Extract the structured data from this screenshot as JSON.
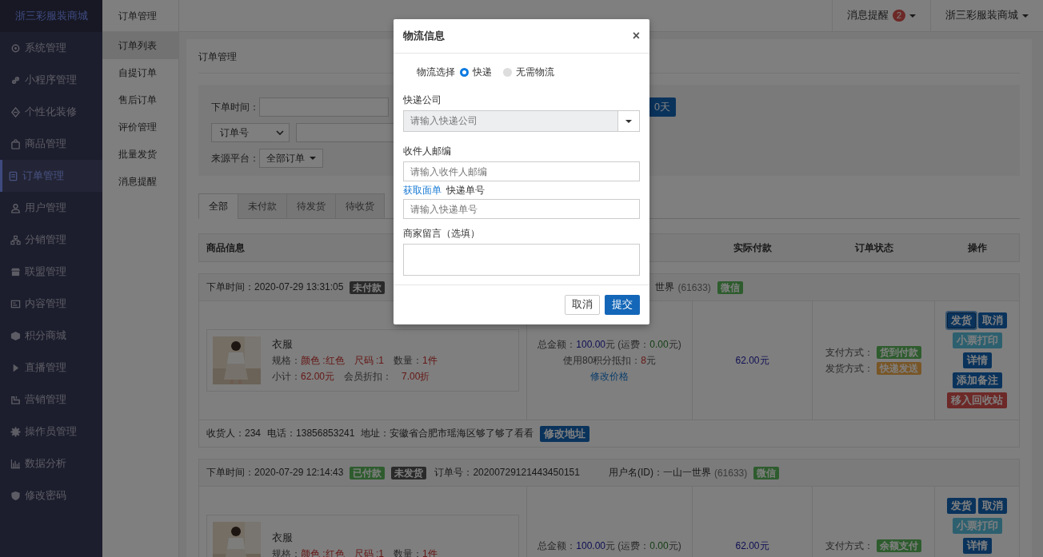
{
  "sidebar": {
    "brand": "浙三彩服装商城",
    "items": [
      {
        "label": "系统管理",
        "selected": false
      },
      {
        "label": "小程序管理",
        "selected": false
      },
      {
        "label": "个性化装修",
        "selected": false
      },
      {
        "label": "商品管理",
        "selected": false
      },
      {
        "label": "订单管理",
        "selected": true
      },
      {
        "label": "用户管理",
        "selected": false
      },
      {
        "label": "分销管理",
        "selected": false
      },
      {
        "label": "联盟管理",
        "selected": false
      },
      {
        "label": "内容管理",
        "selected": false
      },
      {
        "label": "积分商城",
        "selected": false
      },
      {
        "label": "直播管理",
        "selected": false
      },
      {
        "label": "营销管理",
        "selected": false
      },
      {
        "label": "操作员管理",
        "selected": false
      },
      {
        "label": "数据分析",
        "selected": false
      },
      {
        "label": "修改密码",
        "selected": false
      }
    ]
  },
  "submenu": {
    "title": "订单管理",
    "items": [
      {
        "label": "订单列表",
        "selected": true
      },
      {
        "label": "自提订单",
        "selected": false
      },
      {
        "label": "售后订单",
        "selected": false
      },
      {
        "label": "评价管理",
        "selected": false
      },
      {
        "label": "批量发货",
        "selected": false
      },
      {
        "label": "消息提醒",
        "selected": false
      }
    ]
  },
  "topbar": {
    "notifications": {
      "label": "消息提醒",
      "count": "2"
    },
    "account": "浙三彩服装商城"
  },
  "page": {
    "title": "订单管理",
    "filters": {
      "time_label": "下单时间：",
      "range_button": "0天",
      "search_type": "订单号",
      "source_label": "来源平台：",
      "source_value": "全部订单"
    },
    "tabs": [
      {
        "label": "全部",
        "selected": true
      },
      {
        "label": "未付款",
        "selected": false
      },
      {
        "label": "待发货",
        "selected": false
      },
      {
        "label": "待收货",
        "selected": false
      }
    ],
    "columns": [
      "商品信息",
      "实际付款",
      "订单状态",
      "操作"
    ],
    "orders": [
      {
        "time": "下单时间：2020-07-29 13:31:05",
        "badges": [
          {
            "label": "未付款",
            "color": "#2a2a2a"
          }
        ],
        "user": "世界",
        "user_id": "(61633)",
        "platform": "微信",
        "product": {
          "name": "衣服",
          "lines": [
            [
              {
                "text": "规格：",
                "kind": "label"
              },
              {
                "text": "颜色 :红色",
                "kind": "value"
              },
              {
                "text": "尺码 :1",
                "kind": "value"
              },
              {
                "text": "数量：",
                "kind": "label"
              },
              {
                "text": "1件",
                "kind": "value"
              }
            ],
            [
              {
                "text": "小计：",
                "kind": "label"
              },
              {
                "text": "62.00元",
                "kind": "value"
              },
              {
                "text": "会员折扣：",
                "kind": "label"
              },
              {
                "text": "7.00折",
                "kind": "value"
              }
            ]
          ]
        },
        "amount": [
          [
            {
              "text": "总金额：",
              "kind": "label"
            },
            {
              "text": "100.00",
              "kind": "total"
            },
            {
              "text": "元 (运费：",
              "kind": "label"
            },
            {
              "text": "0.00",
              "kind": "fee"
            },
            {
              "text": "元)",
              "kind": "label"
            }
          ],
          [
            {
              "text": "使用80积分抵扣：",
              "kind": "label"
            },
            {
              "text": "8",
              "kind": "value"
            },
            {
              "text": "元",
              "kind": "label"
            }
          ]
        ],
        "edit_price": "修改价格",
        "paid": "62.00元",
        "statuses": [
          {
            "label": "支付方式：",
            "value": "货到付款",
            "color": "#2e5c2e"
          },
          {
            "label": "发货方式：",
            "value": "快递发送",
            "color": "#785627"
          }
        ],
        "actions": [
          [
            {
              "label": "发货",
              "kind": "primary",
              "focused": true
            },
            {
              "label": "取消",
              "kind": "primary",
              "focused": false
            }
          ],
          [
            {
              "label": "小票打印",
              "kind": "info",
              "focused": false
            }
          ],
          [
            {
              "label": "详情",
              "kind": "primary",
              "focused": false
            }
          ],
          [
            {
              "label": "添加备注",
              "kind": "primary",
              "focused": false
            }
          ],
          [
            {
              "label": "移入回收站",
              "kind": "danger",
              "focused": false
            }
          ]
        ],
        "address": {
          "receiver": "收货人：234",
          "phone": "电话：13856853241",
          "address": "地址：安徽省合肥市瑶海区够了够了看看",
          "button": "修改地址"
        }
      },
      {
        "time": "下单时间：2020-07-29 12:14:43",
        "badges": [
          {
            "label": "已付款",
            "color": "#2e5c2e"
          },
          {
            "label": "未发货",
            "color": "#2a2a2a"
          }
        ],
        "order_no": "订单号：20200729121443450151",
        "user": "用户名(ID)：一山一世界",
        "user_id": "(61633)",
        "platform": "微信",
        "product": {
          "name": "衣服",
          "lines": [
            [
              {
                "text": "规格：",
                "kind": "label"
              },
              {
                "text": "颜色 :红色",
                "kind": "value"
              },
              {
                "text": "尺码 :1",
                "kind": "value"
              },
              {
                "text": "数量：",
                "kind": "label"
              },
              {
                "text": "1件",
                "kind": "value"
              }
            ]
          ]
        },
        "amount": [
          [
            {
              "text": "总金额：",
              "kind": "label"
            },
            {
              "text": "100.00",
              "kind": "total"
            },
            {
              "text": "元 (运费：",
              "kind": "label"
            },
            {
              "text": "0.00",
              "kind": "fee"
            },
            {
              "text": "元)",
              "kind": "label"
            }
          ]
        ],
        "paid": "62.00元",
        "statuses": [
          {
            "label": "支付方式：",
            "value": "余额支付",
            "color": "#2e5c2e"
          }
        ],
        "actions": [
          [
            {
              "label": "发货",
              "kind": "primary",
              "focused": false
            },
            {
              "label": "取消",
              "kind": "primary",
              "focused": false
            }
          ],
          [
            {
              "label": "小票打印",
              "kind": "info",
              "focused": false
            }
          ],
          [
            {
              "label": "详情",
              "kind": "primary",
              "focused": false
            }
          ]
        ]
      }
    ]
  },
  "dialog": {
    "title": "物流信息",
    "close": "×",
    "shipping_label": "物流选择",
    "shipping_options": [
      {
        "label": "快递",
        "selected": true
      },
      {
        "label": "无需物流",
        "selected": false
      }
    ],
    "company_label": "快递公司",
    "company_placeholder": "请输入快递公司",
    "zip_label": "收件人邮编",
    "zip_placeholder": "请输入收件人邮编",
    "waybill_link": "获取面单",
    "tracking_label": "快递单号",
    "tracking_placeholder": "请输入快递单号",
    "note_label": "商家留言（选填）",
    "buttons": [
      {
        "label": "取消",
        "kind": "default"
      },
      {
        "label": "提交",
        "kind": "primary"
      }
    ]
  }
}
